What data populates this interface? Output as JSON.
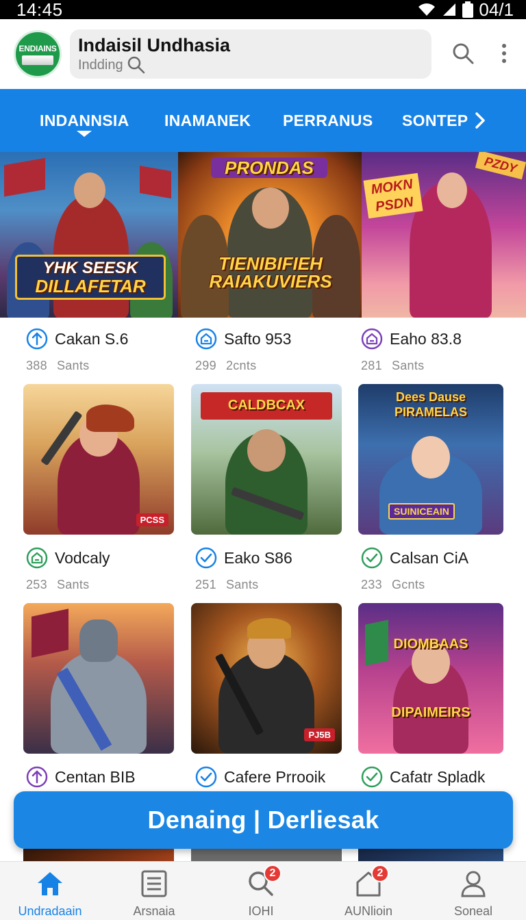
{
  "status_bar": {
    "time": "14:45",
    "battery_text": "04/1"
  },
  "header": {
    "logo_text": "ENDIAINS",
    "title": "Indaisil Undhasia",
    "search_placeholder": "Indding"
  },
  "tabs": [
    {
      "label": "INDANNSIA",
      "active": true
    },
    {
      "label": "INAMANEK",
      "active": false
    },
    {
      "label": "PERRANUS",
      "active": false
    },
    {
      "label": "SONTEP",
      "active": false
    }
  ],
  "banner": {
    "panels": [
      {
        "caption_line1": "YHK SEESK",
        "caption_line2": "DILLAFETAR"
      },
      {
        "caption_top": "PRONDAS",
        "caption_line1": "TIENIBIFIEH",
        "caption_line2": "RAIAKUVIERS"
      },
      {
        "caption_line1": "MOKN",
        "caption_line2": "PSDN",
        "caption_corner": "PZDY"
      }
    ]
  },
  "banner_items": [
    {
      "title": "Cakan S.6",
      "count": "388",
      "unit": "Sants",
      "icon": "arrow-up-circle-icon",
      "color": "#1782e6"
    },
    {
      "title": "Safto 953",
      "count": "299",
      "unit": "2cnts",
      "icon": "home-circle-icon",
      "color": "#1782e6"
    },
    {
      "title": "Eaho 83.8",
      "count": "281",
      "unit": "Sants",
      "icon": "home-circle-icon",
      "color": "#7b3fb8"
    }
  ],
  "games_row1": [
    {
      "title": "Vodcaly",
      "count": "253",
      "unit": "Sants",
      "icon": "home-circle-icon",
      "color": "#2e9e5b",
      "tile_tag": "PCSS",
      "tile_caption": ""
    },
    {
      "title": "Eako S86",
      "count": "251",
      "unit": "Sants",
      "icon": "check-circle-icon",
      "color": "#1782e6",
      "tile_tag": "",
      "tile_caption": "CALDBCAX"
    },
    {
      "title": "Calsan CiA",
      "count": "233",
      "unit": "Gcnts",
      "icon": "check-circle-icon",
      "color": "#2e9e5b",
      "tile_tag": "SUINICEAIN",
      "tile_caption": "Dees Dause PIRAMELAS"
    }
  ],
  "games_row2": [
    {
      "title": "Centan BIB",
      "icon": "arrow-up-circle-icon",
      "color": "#7b3fb8",
      "tile_tag": "",
      "tile_caption": ""
    },
    {
      "title": "Cafere Prrooik",
      "icon": "check-circle-icon",
      "color": "#1782e6",
      "tile_tag": "PJ5B",
      "tile_caption": ""
    },
    {
      "title": "Cafatr Spladk",
      "icon": "check-circle-icon",
      "color": "#2e9e5b",
      "tile_tag": "",
      "tile_caption": "DIOMBAAS DIPAIMEIRS"
    }
  ],
  "cta": {
    "label": "Denaing | Derliesak"
  },
  "bottom_nav": [
    {
      "label": "Undradaain",
      "icon": "home-icon",
      "active": true,
      "badge": ""
    },
    {
      "label": "Arsnaia",
      "icon": "list-icon",
      "active": false,
      "badge": ""
    },
    {
      "label": "IOHI",
      "icon": "search-icon",
      "active": false,
      "badge": "2"
    },
    {
      "label": "AUNlioin",
      "icon": "house-outline-icon",
      "active": false,
      "badge": "2"
    },
    {
      "label": "Soneal",
      "icon": "person-icon",
      "active": false,
      "badge": ""
    }
  ],
  "colors": {
    "accent": "#1782e6",
    "green": "#2e9e5b",
    "purple": "#7b3fb8",
    "badge": "#e53935"
  }
}
